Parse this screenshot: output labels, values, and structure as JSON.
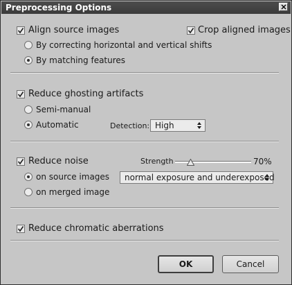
{
  "window": {
    "title": "Preprocessing Options"
  },
  "align": {
    "label": "Align source images",
    "checked": true,
    "crop_label": "Crop aligned images",
    "crop_checked": true,
    "option_shifts": "By correcting horizontal and vertical shifts",
    "option_features": "By matching features",
    "selected": "By matching features"
  },
  "ghosting": {
    "label": "Reduce ghosting artifacts",
    "checked": true,
    "option_semimanual": "Semi-manual",
    "option_automatic": "Automatic",
    "selected": "Automatic",
    "detection_label": "Detection:",
    "detection_value": "High"
  },
  "noise": {
    "label": "Reduce noise",
    "checked": true,
    "strength_label": "Strength",
    "strength_value": "70%",
    "strength_fraction": 0.2,
    "option_source": "on source images",
    "option_merged": "on merged image",
    "selected": "on source images",
    "exposure_value": "normal exposure and underexposed"
  },
  "chromatic": {
    "label": "Reduce chromatic aberrations",
    "checked": true
  },
  "buttons": {
    "ok": "OK",
    "cancel": "Cancel"
  },
  "icons": {
    "close": "close-icon",
    "check": "check-icon",
    "dropdown": "dropdown-arrows-icon",
    "slider": "slider-thumb-icon"
  }
}
